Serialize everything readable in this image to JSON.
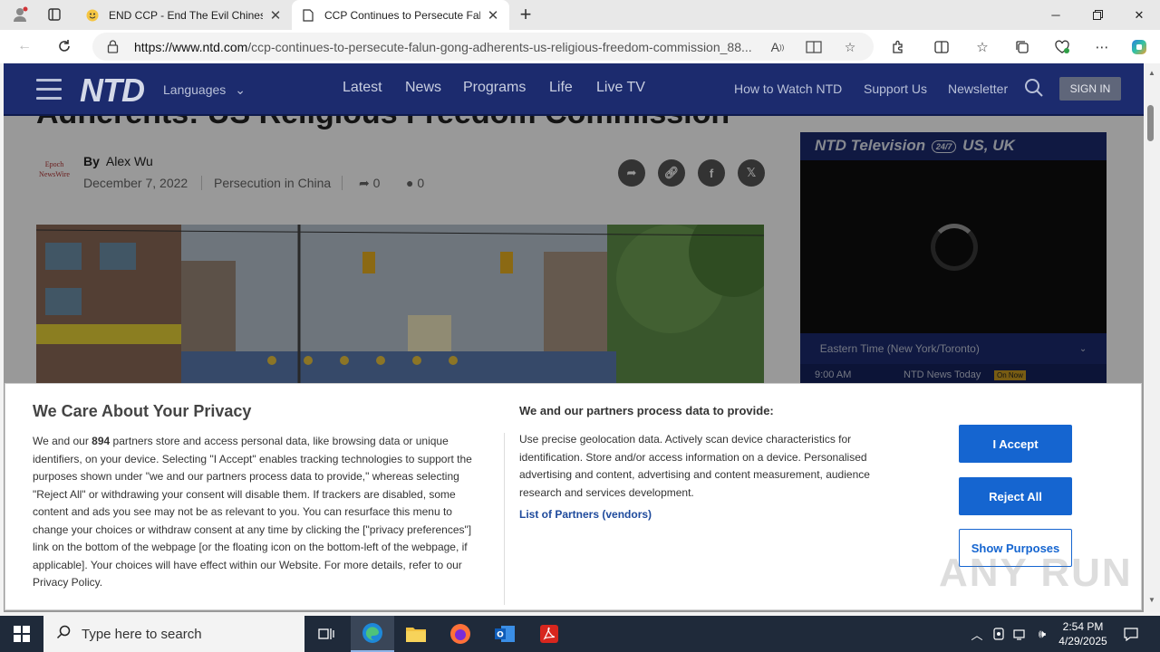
{
  "browser": {
    "tabs": [
      {
        "title": "END CCP - End The Evil Chinese",
        "active": false
      },
      {
        "title": "CCP Continues to Persecute Falu",
        "active": true
      }
    ],
    "url_host": "https://www.ntd.com",
    "url_path": "/ccp-continues-to-persecute-falun-gong-adherents-us-religious-freedom-commission_88...",
    "new_tab_label": "+"
  },
  "site": {
    "logo": "NTD",
    "languages_label": "Languages",
    "nav": [
      "Latest",
      "News",
      "Programs",
      "Life",
      "Live TV"
    ],
    "secondary_nav": [
      "How to Watch NTD",
      "Support Us",
      "Newsletter"
    ],
    "signin_label": "SIGN IN"
  },
  "article": {
    "title": "Adherents: US Religious Freedom Commission",
    "byline_logo": "Epoch NewsWire",
    "by_label": "By",
    "author": "Alex Wu",
    "date": "December 7, 2022",
    "category": "Persecution in China",
    "shares": "0",
    "comments": "0"
  },
  "tv": {
    "title_left": "NTD Television",
    "badge": "24/7",
    "title_right": "US, UK",
    "timezone": "Eastern Time (New York/Toronto)",
    "schedule_time": "9:00 AM",
    "schedule_show": "NTD News Today",
    "schedule_badge": "On Now"
  },
  "consent": {
    "title": "We Care About Your Privacy",
    "body_pre": "We and our",
    "partner_count": "894",
    "body_post": "partners store and access personal data, like browsing data or unique identifiers, on your device. Selecting \"I Accept\" enables tracking technologies to support the purposes shown under \"we and our partners process data to provide,\" whereas selecting \"Reject All\" or withdrawing your consent will disable them. If trackers are disabled, some content and ads you see may not be as relevant to you. You can resurface this menu to change your choices or withdraw consent at any time by clicking the [\"privacy preferences\"] link on the bottom of the webpage [or the floating icon on the bottom-left of the webpage, if applicable]. Your choices will have effect within our Website. For more details, refer to our Privacy Policy.",
    "subtitle": "We and our partners process data to provide:",
    "purposes": "Use precise geolocation data. Actively scan device characteristics for identification. Store and/or access information on a device. Personalised advertising and content, advertising and content measurement, audience research and services development.",
    "partners_link": "List of Partners (vendors)",
    "accept_label": "I Accept",
    "reject_label": "Reject All",
    "purposes_label": "Show Purposes",
    "watermark": "ANY RUN"
  },
  "taskbar": {
    "search_placeholder": "Type here to search",
    "time": "2:54 PM",
    "date": "4/29/2025"
  },
  "colors": {
    "ntd_navy": "#1c2b6e",
    "consent_blue": "#1565d0",
    "taskbar": "#1f2a3a"
  }
}
